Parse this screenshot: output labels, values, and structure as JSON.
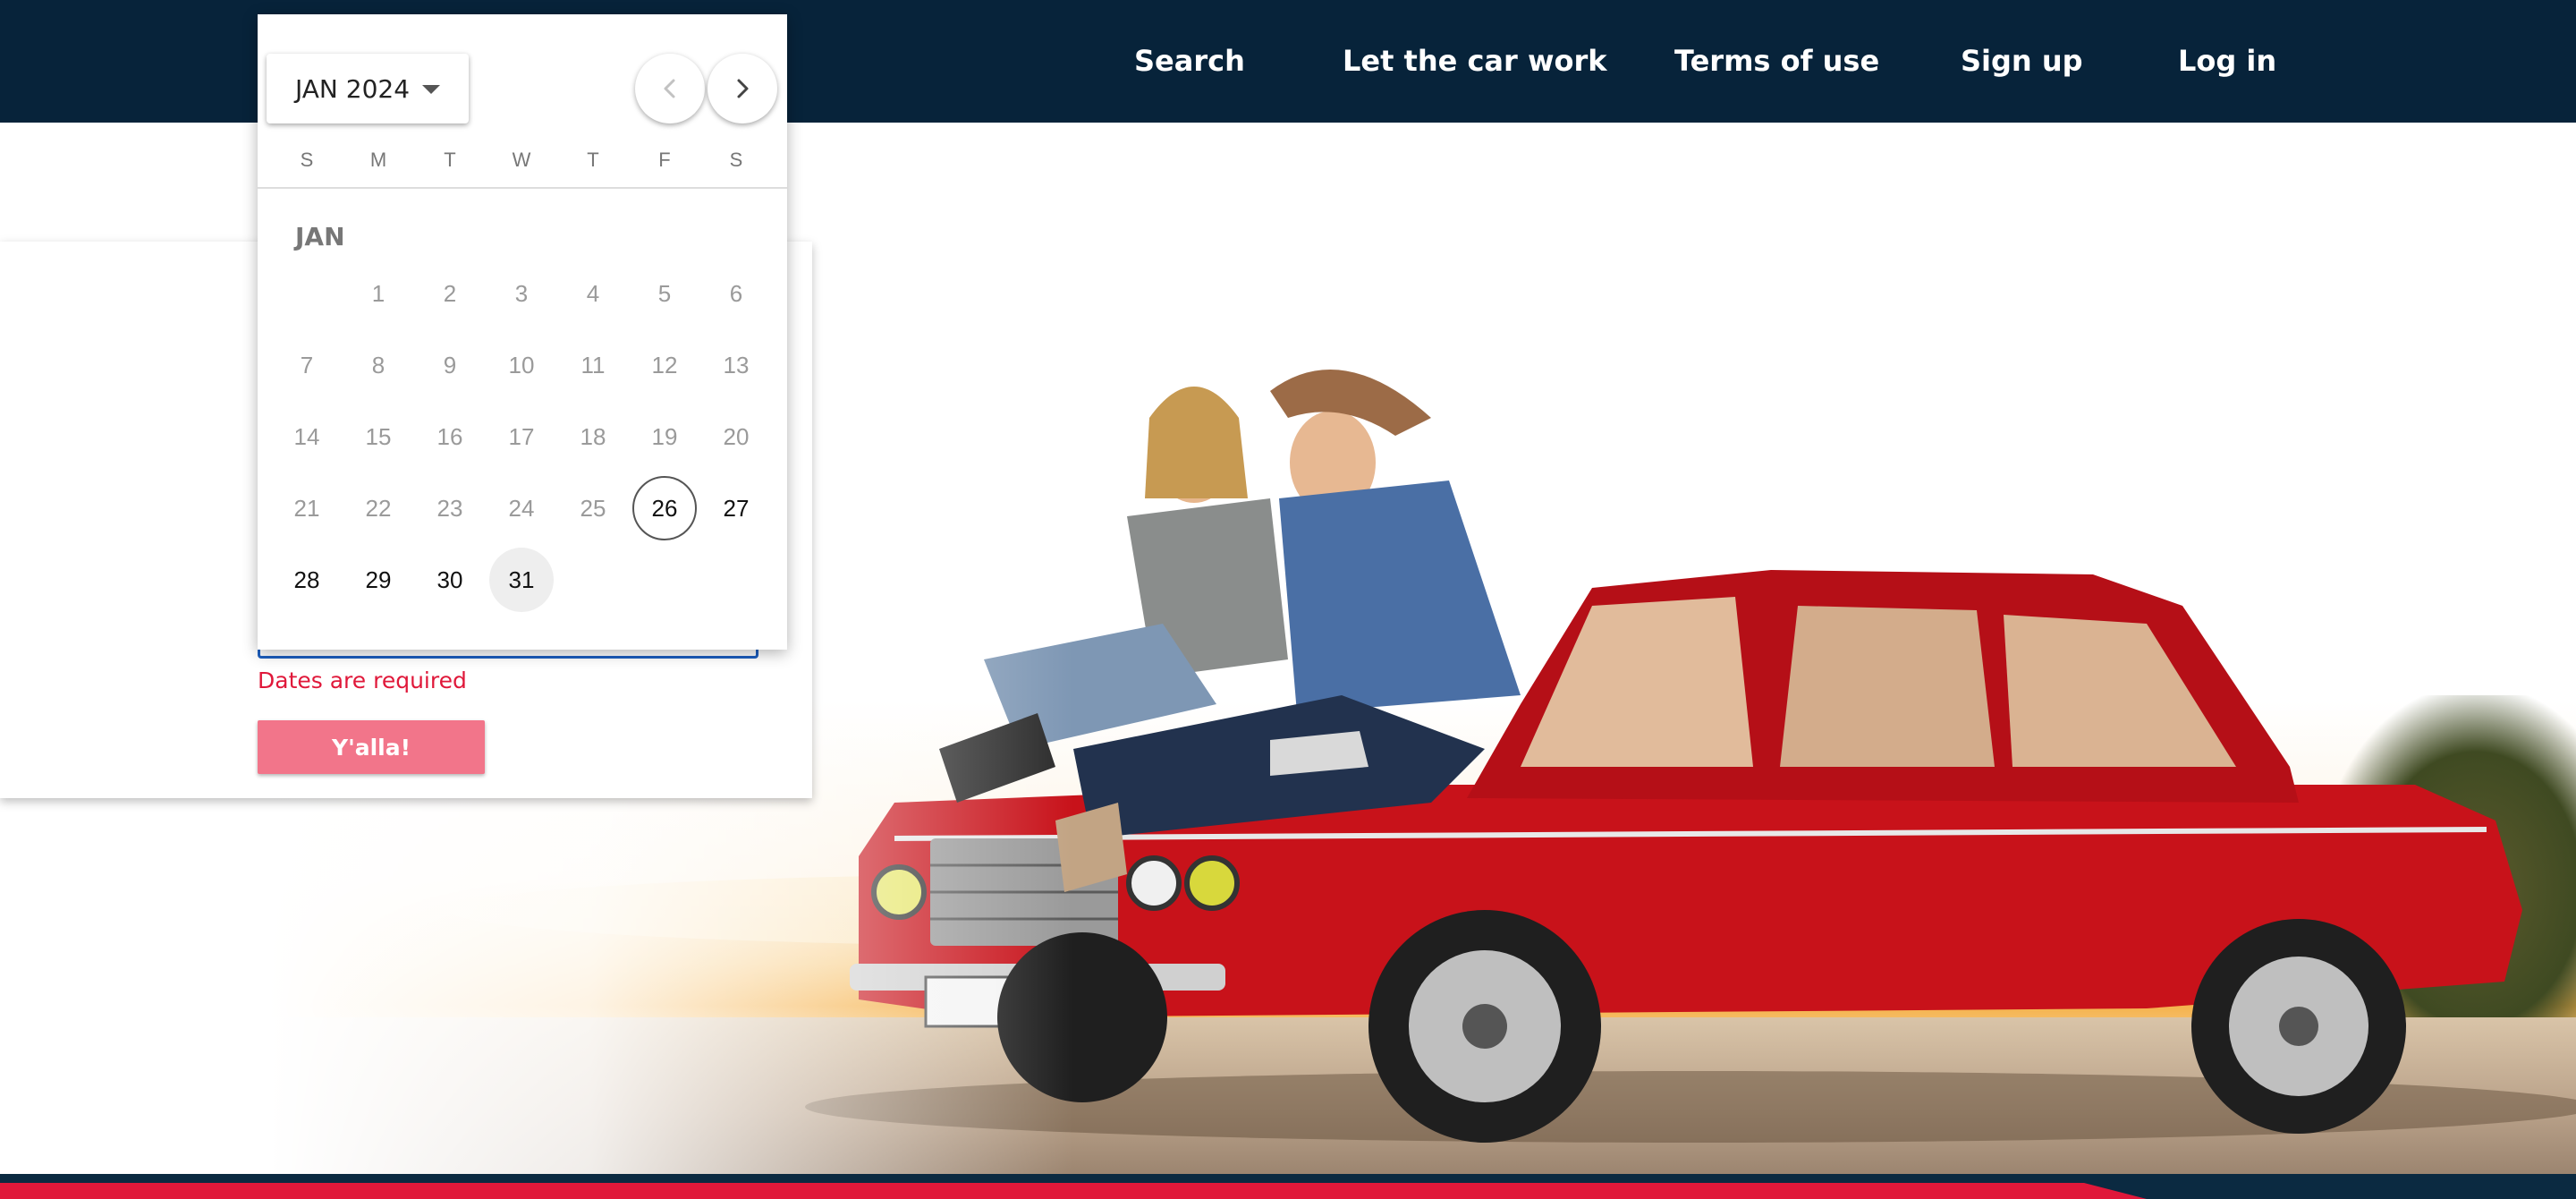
{
  "nav": {
    "items": [
      {
        "label": "Search"
      },
      {
        "label": "Let the car work"
      },
      {
        "label": "Terms of use"
      },
      {
        "label": "Sign up"
      },
      {
        "label": "Log in"
      }
    ]
  },
  "calendar": {
    "month_button": "JAN 2024",
    "month_name": "JAN",
    "weekdays": [
      "S",
      "M",
      "T",
      "W",
      "T",
      "F",
      "S"
    ],
    "days": [
      "1",
      "2",
      "3",
      "4",
      "5",
      "6",
      "7",
      "8",
      "9",
      "10",
      "11",
      "12",
      "13",
      "14",
      "15",
      "16",
      "17",
      "18",
      "19",
      "20",
      "21",
      "22",
      "23",
      "24",
      "25",
      "26",
      "27",
      "28",
      "29",
      "30",
      "31"
    ],
    "today": "26",
    "hovered": "31",
    "prev_icon": "chevron-left-icon",
    "next_icon": "chevron-right-icon"
  },
  "form": {
    "error": "Dates are required",
    "submit_label": "Y'alla!"
  },
  "colors": {
    "nav_bg": "#07233a",
    "error": "#e0183a",
    "button": "#f2758a",
    "field_border": "#1d5fbf",
    "car": "#c8121a"
  }
}
